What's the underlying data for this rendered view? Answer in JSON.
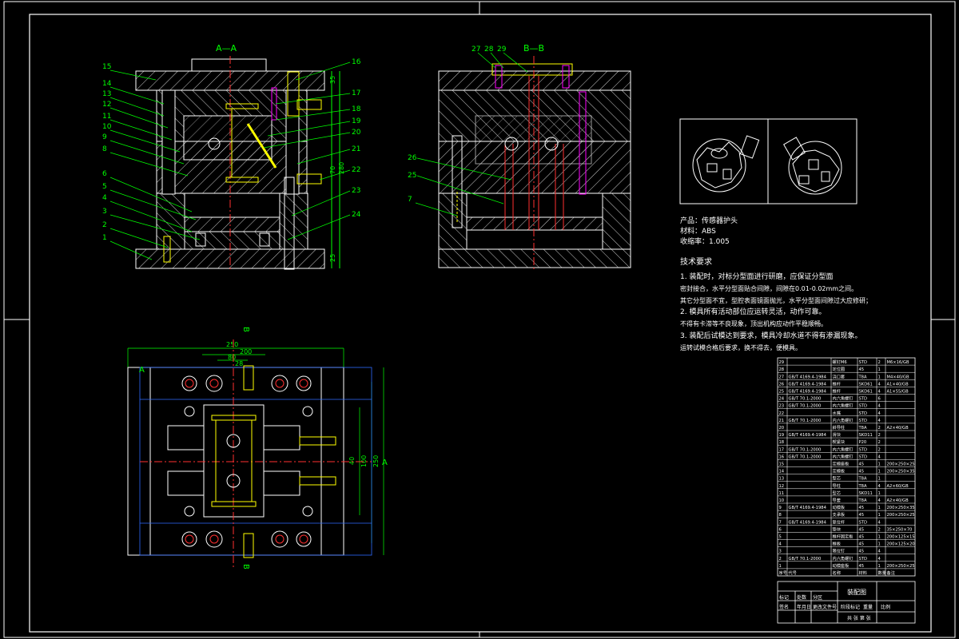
{
  "colors": {
    "background": "#000000",
    "frame": "#ffffff",
    "green": "#00ff00",
    "yellow": "#ffff00",
    "red": "#ff3030",
    "magenta": "#ff00ff",
    "cyan": "#00ffff",
    "blue": "#2f6bff",
    "hatch": "#ffffff"
  },
  "views": {
    "section_aa": "A—A",
    "section_bb": "B—B",
    "plan_marker_a": "A",
    "plan_marker_a2": "A",
    "plan_marker_b": "B",
    "plan_marker_b2": "B"
  },
  "part_labels_left": [
    "15",
    "14",
    "13",
    "12",
    "11",
    "10",
    "9",
    "8",
    "6",
    "5",
    "4",
    "3",
    "2",
    "1"
  ],
  "part_labels_right": [
    "16",
    "17",
    "18",
    "19",
    "20",
    "21",
    "22",
    "23",
    "24"
  ],
  "part_labels_bb": [
    "27",
    "28",
    "29",
    "26",
    "25",
    "7"
  ],
  "dimensions": {
    "d200_top": "200",
    "d250_top": "250",
    "d80": "80",
    "d28": "28",
    "d40": "40",
    "d100": "100",
    "d250_side": "250",
    "v_aa_1": "35",
    "v_aa_2": "70",
    "v_aa_3": "280",
    "v_aa_4": "25"
  },
  "product_info": {
    "product": "产品：传感器护头",
    "material": "材料：ABS",
    "shrinkage": "收缩率：1.005"
  },
  "tech_requirements": {
    "title": "技术要求",
    "lines": [
      "1. 装配时，对标分型面进行研磨，应保证分型面",
      "密封接合，水平分型面贴合间隙，间隙在0.01-0.02mm之间。",
      "其它分型面不宜，型腔表面镜面抛光，水平分型面间隙过大应修研；",
      "2. 模具所有活动部位应运转灵活，动作可靠。",
      "不得有卡滞等不良现象，顶出机构应动作平稳顺畅。",
      "3. 装配后试模达到要求，模具冷却水道不得有渗漏现象。",
      "运转试模合格后要求，换不得去，便模具。"
    ]
  },
  "bom": {
    "rows": [
      {
        "no": "29",
        "std": "",
        "name": "螺钉M6",
        "mat": "STD",
        "qty": "2",
        "note": "M6×16/GB"
      },
      {
        "no": "28",
        "std": "",
        "name": "定位圈",
        "mat": "45",
        "qty": "1",
        "note": ""
      },
      {
        "no": "27",
        "std": "GB/T 4169.4-1984",
        "name": "浇口套",
        "mat": "T8A",
        "qty": "1",
        "note": "M4×40/GB"
      },
      {
        "no": "26",
        "std": "GB/T 4169.4-1984",
        "name": "推杆",
        "mat": "SKD61",
        "qty": "4",
        "note": "A1×40/GB"
      },
      {
        "no": "25",
        "std": "GB/T 4169.4-1984",
        "name": "推杆",
        "mat": "SKD61",
        "qty": "4",
        "note": "A1×55/GB"
      },
      {
        "no": "24",
        "std": "GB/T 70.1-2000",
        "name": "内六角螺钉",
        "mat": "STD",
        "qty": "6",
        "note": ""
      },
      {
        "no": "23",
        "std": "GB/T 70.1-2000",
        "name": "内六角螺钉",
        "mat": "STD",
        "qty": "4",
        "note": ""
      },
      {
        "no": "22",
        "std": "",
        "name": "水嘴",
        "mat": "STD",
        "qty": "4",
        "note": ""
      },
      {
        "no": "21",
        "std": "GB/T 70.1-2000",
        "name": "内六角螺钉",
        "mat": "STD",
        "qty": "4",
        "note": ""
      },
      {
        "no": "20",
        "std": "",
        "name": "斜导柱",
        "mat": "T8A",
        "qty": "2",
        "note": "A2×40/GB"
      },
      {
        "no": "19",
        "std": "GB/T 4169.4-1984",
        "name": "滑块",
        "mat": "SKD11",
        "qty": "2",
        "note": ""
      },
      {
        "no": "18",
        "std": "",
        "name": "楔紧块",
        "mat": "P20",
        "qty": "2",
        "note": ""
      },
      {
        "no": "17",
        "std": "GB/T 70.1-2000",
        "name": "内六角螺钉",
        "mat": "STD",
        "qty": "2",
        "note": ""
      },
      {
        "no": "16",
        "std": "GB/T 70.1-2000",
        "name": "内六角螺钉",
        "mat": "STD",
        "qty": "4",
        "note": ""
      },
      {
        "no": "15",
        "std": "",
        "name": "定模座板",
        "mat": "45",
        "qty": "1",
        "note": "200×250×25"
      },
      {
        "no": "14",
        "std": "",
        "name": "定模板",
        "mat": "45",
        "qty": "1",
        "note": "200×250×35"
      },
      {
        "no": "13",
        "std": "",
        "name": "型芯",
        "mat": "T8A",
        "qty": "1",
        "note": ""
      },
      {
        "no": "12",
        "std": "",
        "name": "导柱",
        "mat": "T8A",
        "qty": "4",
        "note": "A2×60/GB"
      },
      {
        "no": "11",
        "std": "",
        "name": "型芯",
        "mat": "SKD11",
        "qty": "1",
        "note": ""
      },
      {
        "no": "10",
        "std": "",
        "name": "导套",
        "mat": "T8A",
        "qty": "4",
        "note": "A2×40/GB"
      },
      {
        "no": "9",
        "std": "GB/T 4169.4-1984",
        "name": "动模板",
        "mat": "45",
        "qty": "1",
        "note": "200×250×35"
      },
      {
        "no": "8",
        "std": "",
        "name": "支承板",
        "mat": "45",
        "qty": "1",
        "note": "200×250×25"
      },
      {
        "no": "7",
        "std": "GB/T 4169.4-1984",
        "name": "复位杆",
        "mat": "STD",
        "qty": "4",
        "note": ""
      },
      {
        "no": "6",
        "std": "",
        "name": "垫块",
        "mat": "45",
        "qty": "2",
        "note": "35×250×70"
      },
      {
        "no": "5",
        "std": "",
        "name": "推杆固定板",
        "mat": "45",
        "qty": "1",
        "note": "200×125×15"
      },
      {
        "no": "4",
        "std": "",
        "name": "推板",
        "mat": "45",
        "qty": "1",
        "note": "200×125×20"
      },
      {
        "no": "3",
        "std": "",
        "name": "限位钉",
        "mat": "45",
        "qty": "4",
        "note": ""
      },
      {
        "no": "2",
        "std": "GB/T 70.1-2000",
        "name": "内六角螺钉",
        "mat": "STD",
        "qty": "4",
        "note": ""
      },
      {
        "no": "1",
        "std": "",
        "name": "动模座板",
        "mat": "45",
        "qty": "1",
        "note": "200×250×25"
      }
    ],
    "header": {
      "no": "序号",
      "std": "代号",
      "name": "名称",
      "mat": "材料",
      "qty": "数量",
      "note": "备注"
    }
  },
  "title_block": {
    "drawing_name": "装配图",
    "row_labels": [
      "标记",
      "处数",
      "分区",
      "更改文件号",
      "签名",
      "年月日"
    ],
    "sub_labels": [
      "阶段标记",
      "重量",
      "比例"
    ],
    "sheet": "共 张 第 张"
  }
}
